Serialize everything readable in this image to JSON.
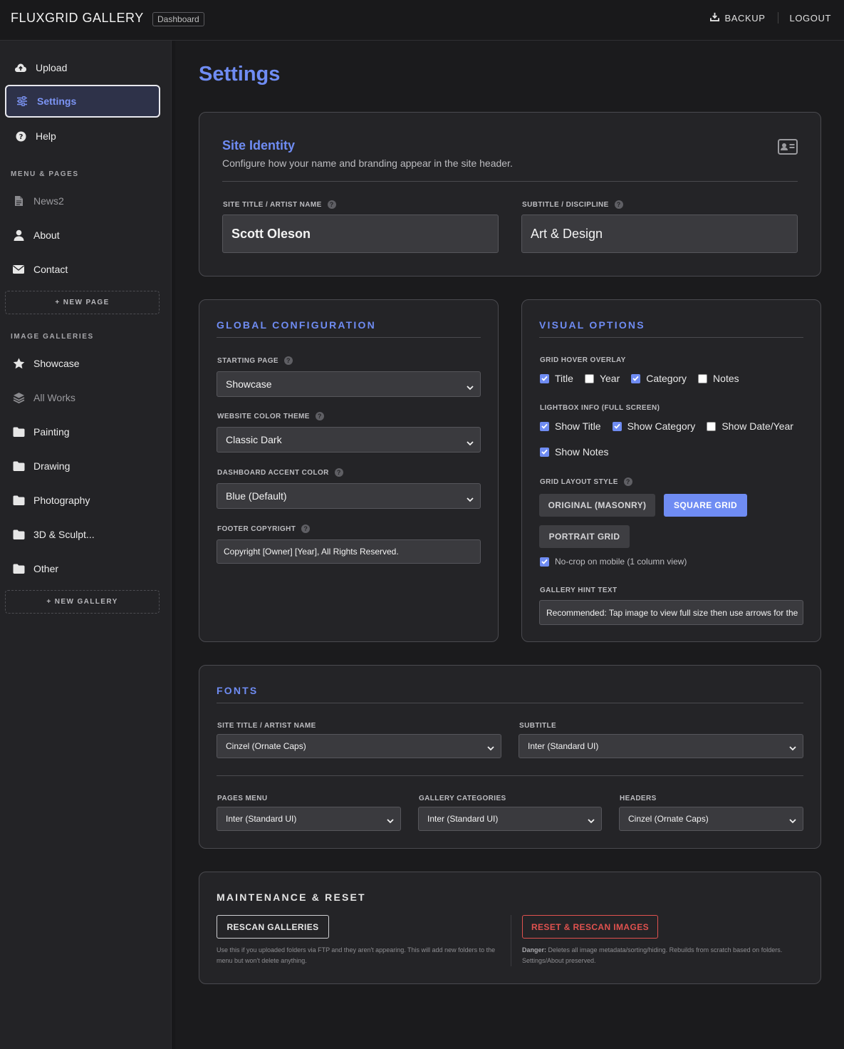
{
  "topbar": {
    "brand": "FLUXGRID GALLERY",
    "badge": "Dashboard",
    "backup_label": "BACKUP",
    "logout_label": "LOGOUT"
  },
  "sidebar": {
    "upload": "Upload",
    "settings": "Settings",
    "help": "Help",
    "menu_section": "MENU & PAGES",
    "pages": [
      "News2",
      "About",
      "Contact"
    ],
    "new_page": "+ NEW PAGE",
    "galleries_section": "IMAGE GALLERIES",
    "galleries": [
      "Showcase",
      "All Works",
      "Painting",
      "Drawing",
      "Photography",
      "3D & Sculpt...",
      "Other"
    ],
    "new_gallery": "+ NEW GALLERY"
  },
  "page_title": "Settings",
  "site_identity": {
    "title": "Site Identity",
    "description": "Configure how your name and branding appear in the site header.",
    "site_title_label": "SITE TITLE / ARTIST NAME",
    "site_title_value": "Scott Oleson",
    "subtitle_label": "SUBTITLE / DISCIPLINE",
    "subtitle_value": "Art & Design"
  },
  "global_config": {
    "title": "GLOBAL CONFIGURATION",
    "starting_page_label": "STARTING PAGE",
    "starting_page_value": "Showcase",
    "color_theme_label": "WEBSITE COLOR THEME",
    "color_theme_value": "Classic Dark",
    "accent_label": "DASHBOARD ACCENT COLOR",
    "accent_value": "Blue (Default)",
    "footer_label": "FOOTER COPYRIGHT",
    "footer_value": "Copyright [Owner] [Year], All Rights Reserved."
  },
  "visual_options": {
    "title": "VISUAL OPTIONS",
    "hover_label": "GRID HOVER OVERLAY",
    "hover": [
      {
        "label": "Title",
        "checked": true
      },
      {
        "label": "Year",
        "checked": false
      },
      {
        "label": "Category",
        "checked": true
      },
      {
        "label": "Notes",
        "checked": false
      }
    ],
    "lightbox_label": "LIGHTBOX INFO (FULL SCREEN)",
    "lightbox": [
      {
        "label": "Show Title",
        "checked": true
      },
      {
        "label": "Show Category",
        "checked": true
      },
      {
        "label": "Show Date/Year",
        "checked": false
      },
      {
        "label": "Show Notes",
        "checked": true
      }
    ],
    "layout_label": "GRID LAYOUT STYLE",
    "layout_original": "ORIGINAL (MASONRY)",
    "layout_square": "SQUARE GRID",
    "layout_portrait": "PORTRAIT GRID",
    "layout_selected": "SQUARE GRID",
    "nocrop_label": "No-crop on mobile (1 column view)",
    "nocrop_checked": true,
    "hint_label": "GALLERY HINT TEXT",
    "hint_value": "Recommended: Tap image to view full size then use arrows for the"
  },
  "fonts": {
    "title": "FONTS",
    "site_title_label": "SITE TITLE / ARTIST NAME",
    "site_title_value": "Cinzel (Ornate Caps)",
    "subtitle_label": "SUBTITLE",
    "subtitle_value": "Inter (Standard UI)",
    "pages_menu_label": "PAGES MENU",
    "pages_menu_value": "Inter (Standard UI)",
    "gallery_categories_label": "GALLERY CATEGORIES",
    "gallery_categories_value": "Inter (Standard UI)",
    "headers_label": "HEADERS",
    "headers_value": "Cinzel (Ornate Caps)"
  },
  "maintenance": {
    "title": "MAINTENANCE & RESET",
    "rescan_label": "RESCAN GALLERIES",
    "rescan_note": "Use this if you uploaded folders via FTP and they aren't appearing. This will add new folders to the menu but won't delete anything.",
    "reset_label": "RESET & RESCAN IMAGES",
    "reset_note_prefix": "Danger:",
    "reset_note": "Deletes all image metadata/sorting/hiding. Rebuilds from scratch based on folders. Settings/About preserved."
  },
  "colors": {
    "accent": "#6f8cf3",
    "danger": "#e0524f",
    "background": "#1b1b1d",
    "card": "#242427"
  }
}
